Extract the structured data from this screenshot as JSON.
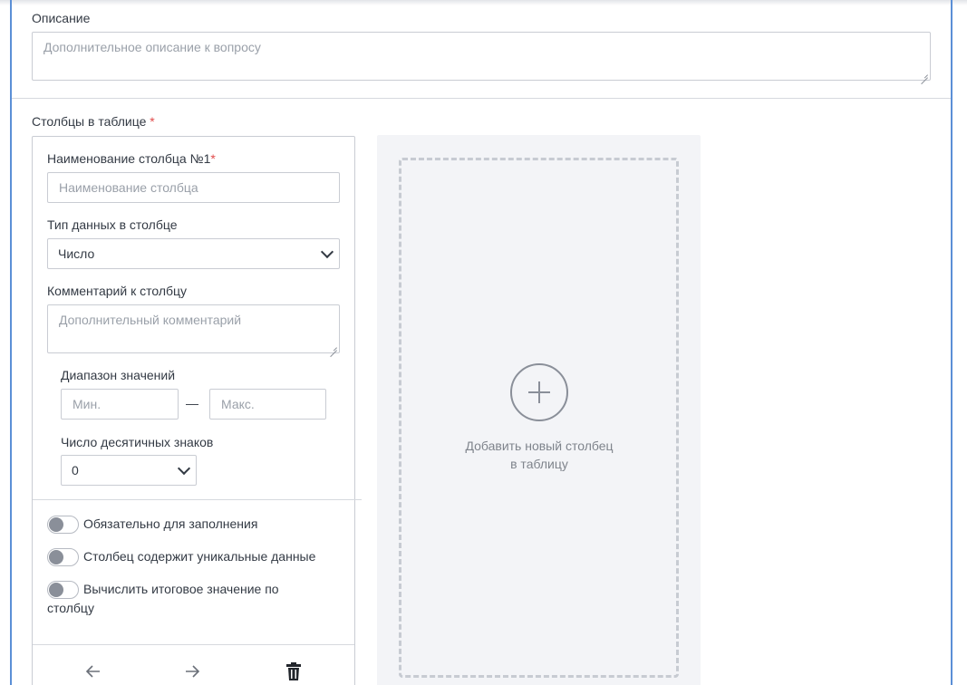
{
  "description": {
    "label": "Описание",
    "placeholder": "Дополнительное описание к вопросу"
  },
  "columns": {
    "label": "Столбцы в таблице",
    "required_mark": "*"
  },
  "column_card": {
    "name_label": "Наименование столбца №1",
    "name_required_mark": "*",
    "name_placeholder": "Наименование столбца",
    "type_label": "Тип данных в столбце",
    "type_value": "Число",
    "comment_label": "Комментарий к столбцу",
    "comment_placeholder": "Дополнительный комментарий",
    "range_label": "Диапазон значений",
    "range_min_placeholder": "Мин.",
    "range_separator": "—",
    "range_max_placeholder": "Макс.",
    "decimals_label": "Число десятичных знаков",
    "decimals_value": "0",
    "toggles": [
      {
        "label": "Обязательно для заполнения",
        "on": false
      },
      {
        "label": "Столбец содержит уникальные данные",
        "on": false
      },
      {
        "label": "Вычислить итоговое значение по столбцу",
        "on": false
      }
    ],
    "actions": {
      "prev_icon": "arrow-left-icon",
      "next_icon": "arrow-right-icon",
      "delete_icon": "trash-icon"
    }
  },
  "add_column": {
    "line1": "Добавить новый столбец",
    "line2": "в таблицу",
    "icon": "plus-circle-icon"
  },
  "colors": {
    "frame_accent": "#5b8fd6",
    "required": "#e14b4b",
    "panel_bg": "#f3f4f7"
  }
}
